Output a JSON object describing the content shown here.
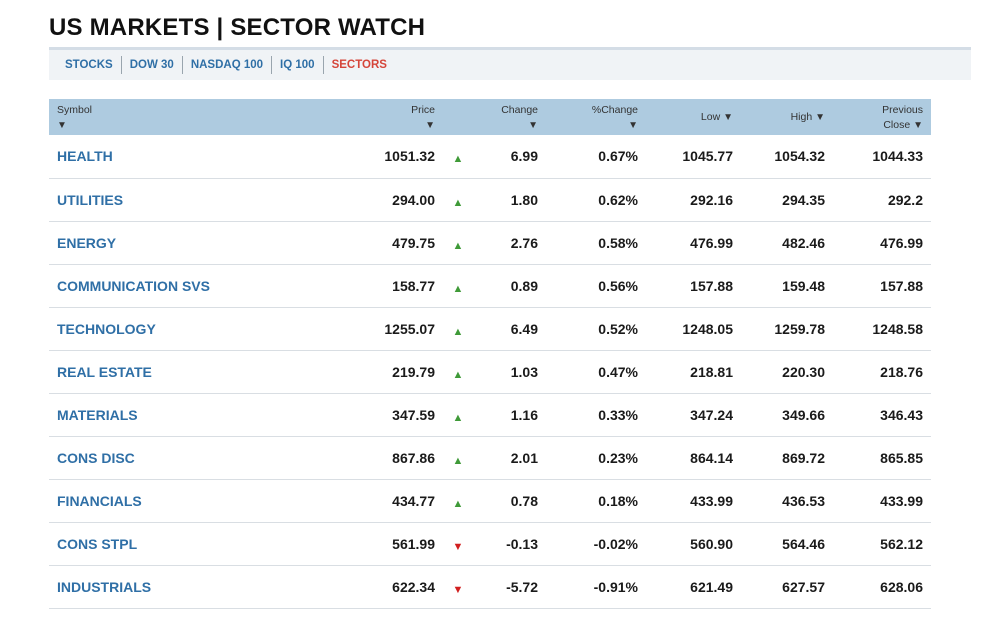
{
  "title": "US MARKETS | SECTOR WATCH",
  "tabs": [
    {
      "label": "STOCKS",
      "active": false
    },
    {
      "label": "DOW 30",
      "active": false
    },
    {
      "label": "NASDAQ 100",
      "active": false
    },
    {
      "label": "IQ 100",
      "active": false
    },
    {
      "label": "SECTORS",
      "active": true
    }
  ],
  "colors": {
    "accent": "#2f6fa6",
    "active_tab": "#d5453a",
    "header_bg": "#aecbe0",
    "up": "#3f9a38",
    "down": "#d11f1f"
  },
  "columns": {
    "symbol": "Symbol",
    "price": "Price",
    "change": "Change",
    "pct_change": "%Change",
    "low": "Low",
    "high": "High",
    "previous_line1": "Previous",
    "previous_line2": "Close",
    "sort_icon": "▼"
  },
  "rows": [
    {
      "symbol": "HEALTH",
      "price": "1051.32",
      "dir": "up",
      "change": "6.99",
      "pct": "0.67%",
      "low": "1045.77",
      "high": "1054.32",
      "prev": "1044.33"
    },
    {
      "symbol": "UTILITIES",
      "price": "294.00",
      "dir": "up",
      "change": "1.80",
      "pct": "0.62%",
      "low": "292.16",
      "high": "294.35",
      "prev": "292.2"
    },
    {
      "symbol": "ENERGY",
      "price": "479.75",
      "dir": "up",
      "change": "2.76",
      "pct": "0.58%",
      "low": "476.99",
      "high": "482.46",
      "prev": "476.99"
    },
    {
      "symbol": "COMMUNICATION SVS",
      "price": "158.77",
      "dir": "up",
      "change": "0.89",
      "pct": "0.56%",
      "low": "157.88",
      "high": "159.48",
      "prev": "157.88"
    },
    {
      "symbol": "TECHNOLOGY",
      "price": "1255.07",
      "dir": "up",
      "change": "6.49",
      "pct": "0.52%",
      "low": "1248.05",
      "high": "1259.78",
      "prev": "1248.58"
    },
    {
      "symbol": "REAL ESTATE",
      "price": "219.79",
      "dir": "up",
      "change": "1.03",
      "pct": "0.47%",
      "low": "218.81",
      "high": "220.30",
      "prev": "218.76"
    },
    {
      "symbol": "MATERIALS",
      "price": "347.59",
      "dir": "up",
      "change": "1.16",
      "pct": "0.33%",
      "low": "347.24",
      "high": "349.66",
      "prev": "346.43"
    },
    {
      "symbol": "CONS DISC",
      "price": "867.86",
      "dir": "up",
      "change": "2.01",
      "pct": "0.23%",
      "low": "864.14",
      "high": "869.72",
      "prev": "865.85"
    },
    {
      "symbol": "FINANCIALS",
      "price": "434.77",
      "dir": "up",
      "change": "0.78",
      "pct": "0.18%",
      "low": "433.99",
      "high": "436.53",
      "prev": "433.99"
    },
    {
      "symbol": "CONS STPL",
      "price": "561.99",
      "dir": "down",
      "change": "-0.13",
      "pct": "-0.02%",
      "low": "560.90",
      "high": "564.46",
      "prev": "562.12"
    },
    {
      "symbol": "INDUSTRIALS",
      "price": "622.34",
      "dir": "down",
      "change": "-5.72",
      "pct": "-0.91%",
      "low": "621.49",
      "high": "627.57",
      "prev": "628.06"
    }
  ]
}
